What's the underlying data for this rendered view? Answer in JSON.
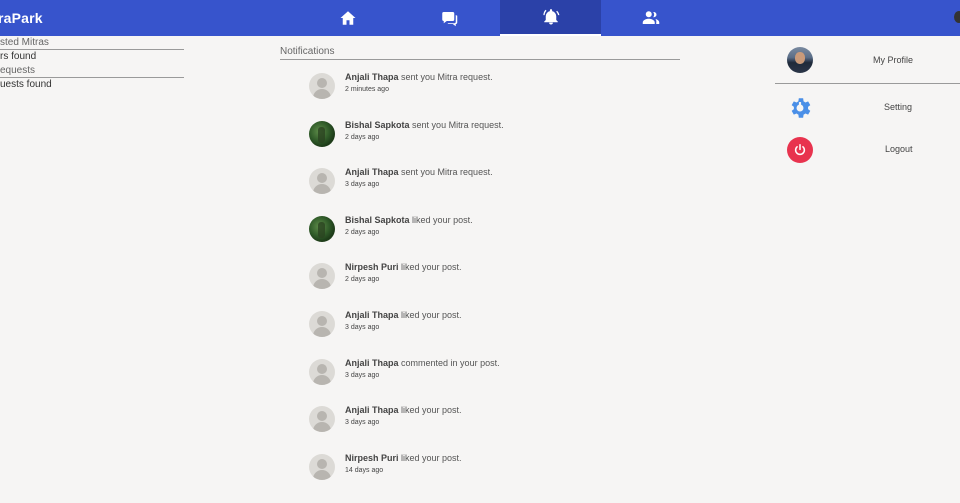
{
  "app": {
    "brand": "raPark"
  },
  "colors": {
    "topbar": "#3754cc",
    "topbar_active": "#2b41a8",
    "logout": "#e8334e",
    "setting": "#4a8fe7"
  },
  "nav": {
    "items": [
      {
        "icon": "home-icon"
      },
      {
        "icon": "chat-icon"
      },
      {
        "icon": "bell-icon",
        "active": true
      },
      {
        "icon": "users-icon"
      }
    ]
  },
  "left": {
    "suggested_title": "sted Mitras",
    "suggested_empty": "rs found",
    "requests_title": "equests",
    "requests_empty": "uests found"
  },
  "notifications": {
    "heading": "Notifications",
    "items": [
      {
        "name": "Anjali Thapa",
        "action": "sent you Mitra request.",
        "time": "2 minutes ago",
        "avatar": "placeholder"
      },
      {
        "name": "Bishal Sapkota",
        "action": "sent you Mitra request.",
        "time": "2 days ago",
        "avatar": "photo"
      },
      {
        "name": "Anjali Thapa",
        "action": "sent you Mitra request.",
        "time": "3 days ago",
        "avatar": "placeholder"
      },
      {
        "name": "Bishal Sapkota",
        "action": "liked your post.",
        "time": "2 days ago",
        "avatar": "photo"
      },
      {
        "name": "Nirpesh Puri",
        "action": "liked your post.",
        "time": "2 days ago",
        "avatar": "placeholder"
      },
      {
        "name": "Anjali Thapa",
        "action": "liked your post.",
        "time": "3 days ago",
        "avatar": "placeholder"
      },
      {
        "name": "Anjali Thapa",
        "action": "commented in your post.",
        "time": "3 days ago",
        "avatar": "placeholder"
      },
      {
        "name": "Anjali Thapa",
        "action": "liked your post.",
        "time": "3 days ago",
        "avatar": "placeholder"
      },
      {
        "name": "Nirpesh Puri",
        "action": "liked your post.",
        "time": "14 days ago",
        "avatar": "placeholder"
      }
    ]
  },
  "menu": {
    "profile_label": "My Profile",
    "setting_label": "Setting",
    "logout_label": "Logout"
  }
}
